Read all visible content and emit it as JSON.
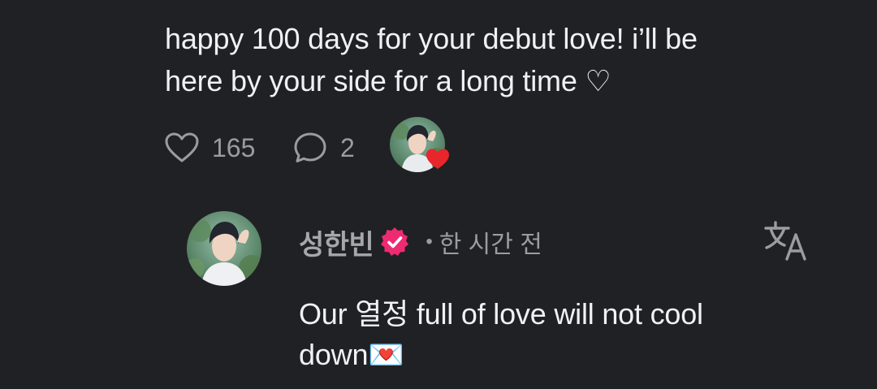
{
  "comment": {
    "line1": "happy 100 days for your debut love! i’ll be",
    "line2": "here by your side for a long time ♡",
    "likes_count": "165",
    "replies_count": "2",
    "icons": {
      "like": "heart-outline-icon",
      "reply": "speech-bubble-icon",
      "liked_badge": "red-heart-icon"
    }
  },
  "reply": {
    "author": "성한빈",
    "time_separator": "•",
    "time": "한 시간 전",
    "line1": "Our 열정 full of love will not cool",
    "line2": "down💌",
    "icons": {
      "verified": "verified-badge-icon",
      "translate": "translate-icon",
      "envelope": "love-letter-icon"
    }
  },
  "colors": {
    "background": "#202125",
    "text": "#f1f1f3",
    "muted": "#9b9ca1",
    "verified_badge": "#ee2a72",
    "heart_badge": "#e8262b"
  }
}
